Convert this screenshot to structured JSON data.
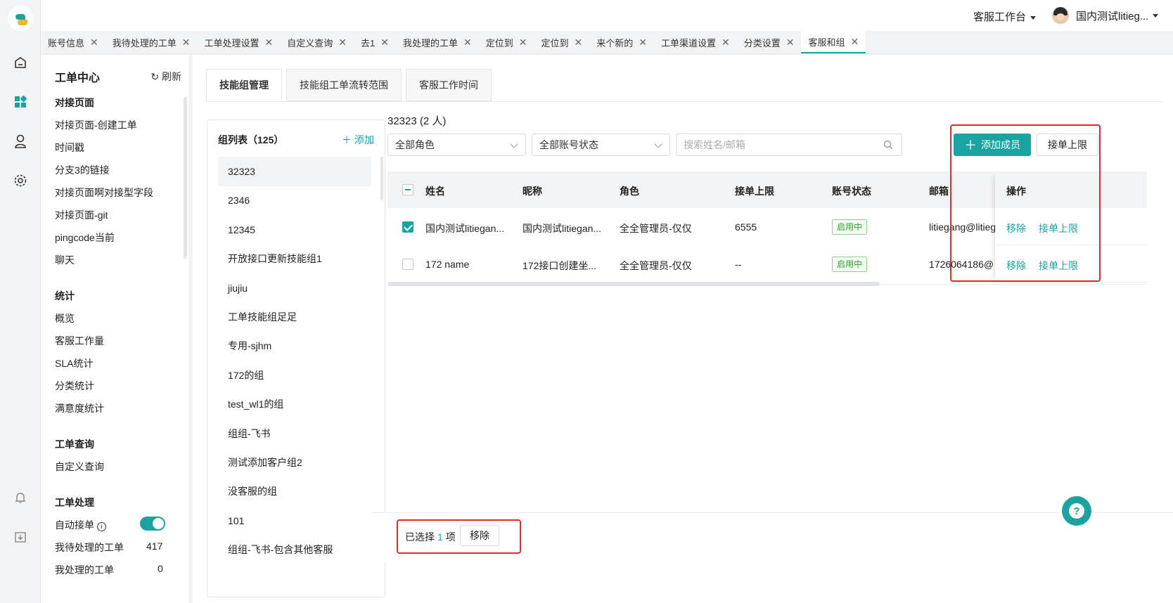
{
  "topbar": {
    "workbench": "客服工作台",
    "user_name": "国内测试litieg..."
  },
  "tabs": [
    {
      "label": "账号信息",
      "active": false
    },
    {
      "label": "我待处理的工单",
      "active": false
    },
    {
      "label": "工单处理设置",
      "active": false
    },
    {
      "label": "自定义查询",
      "active": false
    },
    {
      "label": "去1",
      "active": false
    },
    {
      "label": "我处理的工单",
      "active": false
    },
    {
      "label": "定位到",
      "active": false
    },
    {
      "label": "定位到",
      "active": false
    },
    {
      "label": "来个新的",
      "active": false
    },
    {
      "label": "工单渠道设置",
      "active": false
    },
    {
      "label": "分类设置",
      "active": false
    },
    {
      "label": "客服和组",
      "active": true
    }
  ],
  "menu": {
    "title": "工单中心",
    "refresh": "刷新",
    "sections": [
      {
        "title": "对接页面",
        "items": [
          "对接页面-创建工单",
          "时间戳",
          "分支3的链接",
          "对接页面啊对接型字段",
          "对接页面-git",
          "pingcode当前",
          "聊天"
        ]
      },
      {
        "title": "统计",
        "items": [
          "概览",
          "客服工作量",
          "SLA统计",
          "分类统计",
          "满意度统计"
        ]
      },
      {
        "title": "工单查询",
        "items": [
          "自定义查询"
        ]
      },
      {
        "title": "工单处理",
        "items": []
      }
    ],
    "auto_accept": "自动接单",
    "auto_accept_on": true,
    "my_pending": "我待处理的工单",
    "my_pending_count": "417",
    "my_processed": "我处理的工单",
    "my_processed_count": "0"
  },
  "content_tabs": [
    "技能组管理",
    "技能组工单流转范围",
    "客服工作时间"
  ],
  "group_list": {
    "title": "组列表（125）",
    "add": "添加",
    "groups": [
      "32323",
      "2346",
      "12345",
      "开放接口更新技能组1",
      "jiujiu",
      "工单技能组足足",
      "专用-sjhm",
      "172的组",
      "test_wl1的组",
      "组组-飞书",
      "测试添加客户组2",
      "没客服的组",
      "101",
      "组组-飞书-包含其他客服"
    ]
  },
  "detail": {
    "title": "32323 (2 人)",
    "role_select": "全部角色",
    "status_select": "全部账号状态",
    "search_placeholder": "搜索姓名/邮箱",
    "add_member": "添加成员",
    "limit": "接单上限",
    "columns": [
      "姓名",
      "昵称",
      "角色",
      "接单上限",
      "账号状态",
      "邮箱",
      "操作"
    ],
    "rows": [
      {
        "name": "国内测试litiegan...",
        "nickname": "国内测试litiegan...",
        "role": "全全管理员-仅仅",
        "limit": "6555",
        "status": "启用中",
        "email": "litiegang@litieg",
        "checked": true
      },
      {
        "name": "172 name",
        "nickname": "172接口创建坐...",
        "role": "全全管理员-仅仅",
        "limit": "--",
        "status": "启用中",
        "email": "1726064186@",
        "checked": false
      }
    ],
    "action_remove": "移除",
    "action_limit": "接单上限"
  },
  "footer": {
    "selected_prefix": "已选择",
    "selected_count": "1",
    "selected_suffix": "项",
    "remove": "移除"
  },
  "colors": {
    "accent": "#1aa3a0",
    "highlight": "#e5292b",
    "status_green": "#2e9c2e"
  }
}
